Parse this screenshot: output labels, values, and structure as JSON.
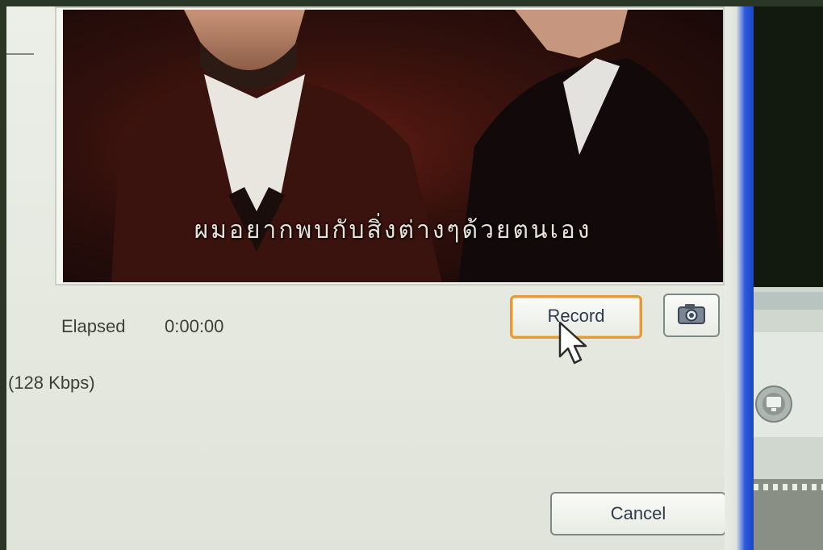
{
  "video": {
    "subtitle": "ผมอยากพบกับสิ่งต่างๆด้วยตนเอง"
  },
  "status": {
    "elapsed_label": "Elapsed",
    "elapsed_value": "0:00:00",
    "bitrate": "(128 Kbps)"
  },
  "buttons": {
    "record_label": "Record",
    "cancel_label": "Cancel",
    "snapshot_icon": "camera-icon"
  },
  "colors": {
    "record_focus_border": "#e29a3c",
    "window_border_blue": "#2a5be0"
  }
}
